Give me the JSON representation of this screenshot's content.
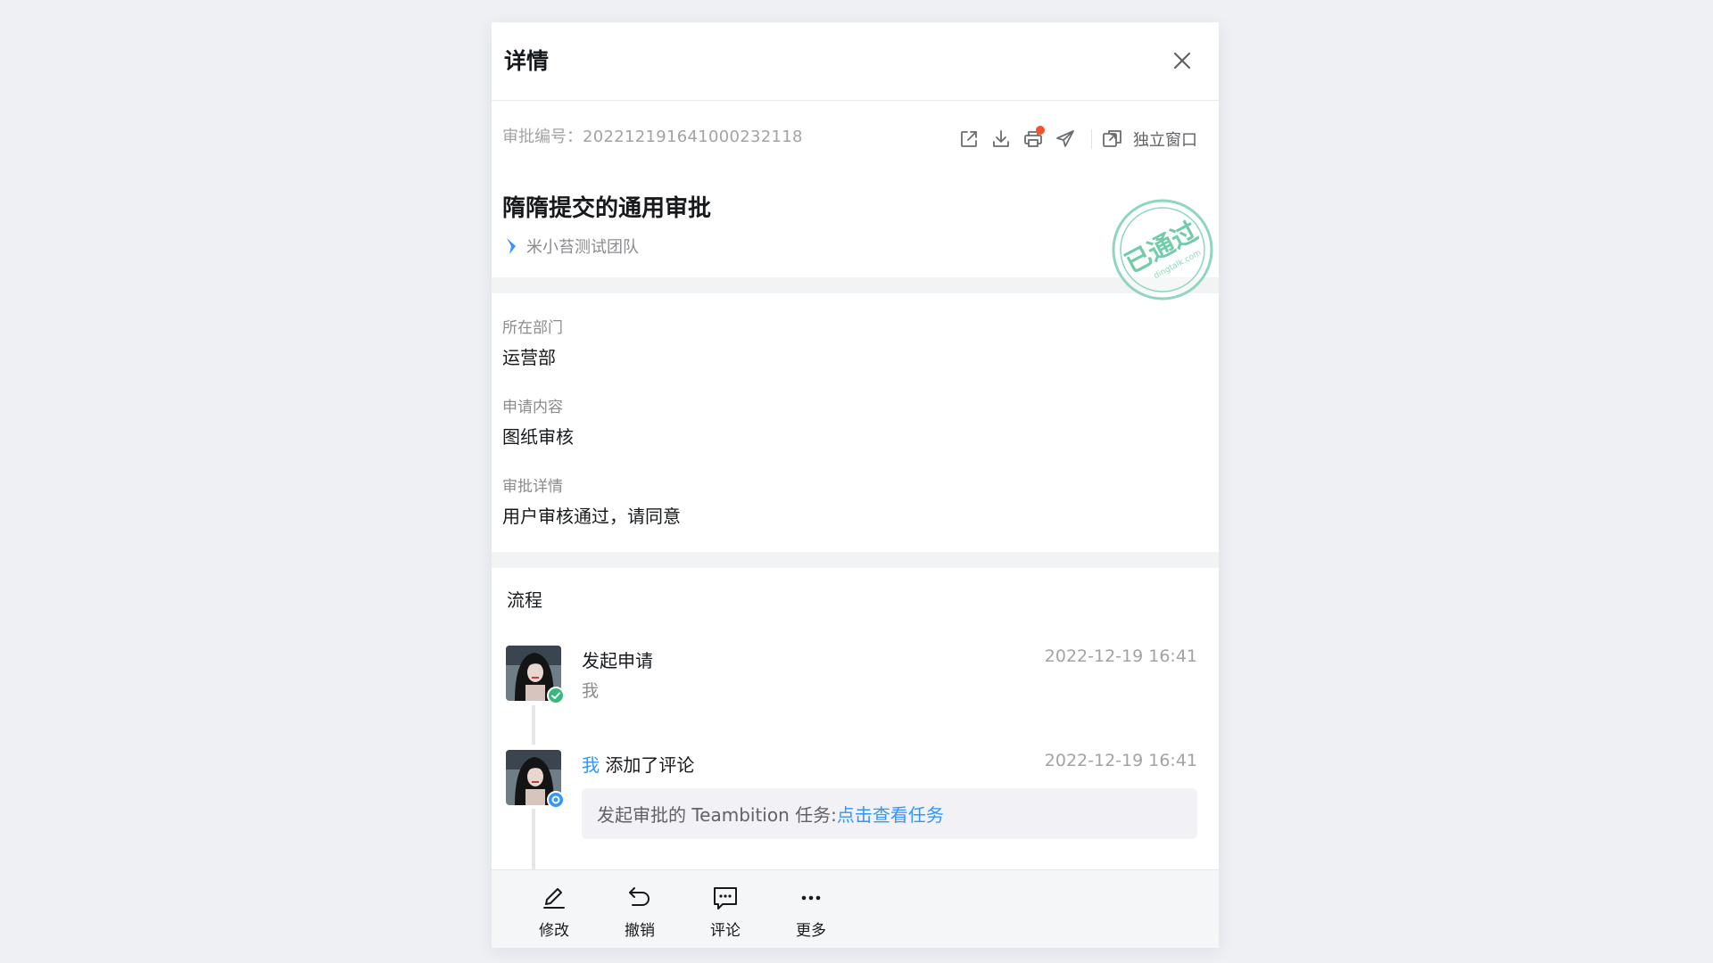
{
  "header": {
    "title": "详情"
  },
  "meta": {
    "approval_no_label": "审批编号：",
    "approval_no": "202212191641000232118",
    "standalone_label": "独立窗口",
    "title": "隋隋提交的通用审批",
    "team": "米小苔测试团队",
    "stamp": {
      "text": "已通过",
      "domain": "dingtalk.com",
      "color": "#5cc5a0"
    }
  },
  "fields": [
    {
      "label": "所在部门",
      "value": "运营部"
    },
    {
      "label": "申请内容",
      "value": "图纸审核"
    },
    {
      "label": "审批详情",
      "value": "用户审核通过，请同意"
    }
  ],
  "flow": {
    "title": "流程",
    "items": [
      {
        "action": "发起申请",
        "person": "我",
        "time": "2022-12-19 16:41",
        "status": "approved",
        "badge_color": "#3bb77e"
      },
      {
        "actor": "我",
        "action": "添加了评论",
        "time": "2022-12-19 16:41",
        "status": "commented",
        "badge_color": "#3296fa",
        "comment_text": "发起审批的 Teambition 任务:",
        "comment_link": "点击查看任务"
      }
    ]
  },
  "actions": [
    {
      "label": "修改",
      "icon": "edit-icon"
    },
    {
      "label": "撤销",
      "icon": "undo-icon"
    },
    {
      "label": "评论",
      "icon": "comment-icon"
    },
    {
      "label": "更多",
      "icon": "more-icon"
    }
  ],
  "colors": {
    "accent": "#3296fa",
    "notification": "#f5512a",
    "approved": "#3bb77e"
  }
}
